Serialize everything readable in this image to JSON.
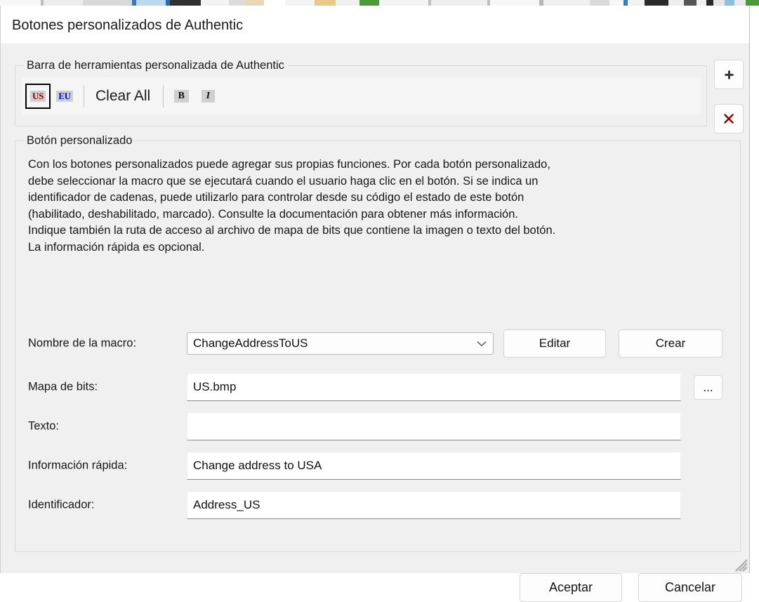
{
  "window": {
    "title": "Botones personalizados de Authentic"
  },
  "toolbar_group": {
    "legend": "Barra de herramientas personalizada de Authentic",
    "buttons": [
      {
        "type": "icon",
        "label": "US",
        "color": "#8b0000",
        "selected": true
      },
      {
        "type": "icon",
        "label": "EU",
        "color": "#0000e0",
        "selected": false
      },
      {
        "type": "separator"
      },
      {
        "type": "text",
        "label": "Clear All",
        "selected": false
      },
      {
        "type": "separator"
      },
      {
        "type": "icon",
        "label": "B",
        "color": "#111111",
        "selected": false
      },
      {
        "type": "icon",
        "label": "I",
        "color": "#111111",
        "selected": false
      }
    ],
    "add_button": {
      "icon": "plus-icon",
      "label": "+",
      "color": "#333333"
    },
    "delete_button": {
      "icon": "delete-x-icon",
      "label": "✖",
      "color": "#8b0000"
    }
  },
  "custom_button_group": {
    "legend": "Botón personalizado",
    "description": "Con los botones personalizados puede agregar sus propias funciones. Por cada botón personalizado,\ndebe seleccionar la macro que se ejecutará cuando el usuario haga clic en el botón. Si se indica un\nidentificador de cadenas, puede utilizarlo para controlar desde su código el estado de este botón\n(habilitado, deshabilitado, marcado). Consulte la documentación para obtener más información.\nIndique también la ruta de acceso al archivo de mapa de bits que contiene la imagen o texto del botón.\nLa información rápida es opcional.",
    "fields": {
      "macro_name": {
        "label": "Nombre de la macro:",
        "value": "ChangeAddressToUS",
        "placeholder": "",
        "edit_button": "Editar",
        "create_button": "Crear"
      },
      "bitmap": {
        "label": "Mapa de bits:",
        "value": "US.bmp",
        "placeholder": "",
        "browse_button": "..."
      },
      "text": {
        "label": "Texto:",
        "value": "",
        "placeholder": ""
      },
      "tooltip": {
        "label": "Información rápida:",
        "value": "Change address to USA",
        "placeholder": ""
      },
      "identifier": {
        "label": "Identificador:",
        "value": "Address_US",
        "placeholder": ""
      }
    }
  },
  "footer": {
    "accept_label": "Aceptar",
    "cancel_label": "Cancelar"
  },
  "colors": {
    "dialog_bg": "#f0f0f0",
    "titlebar_bg": "#ffffff",
    "text": "#171717",
    "input_bg": "#ffffff",
    "accent_red": "#8b0000",
    "accent_blue": "#0000e0",
    "selection_border": "#000000"
  }
}
